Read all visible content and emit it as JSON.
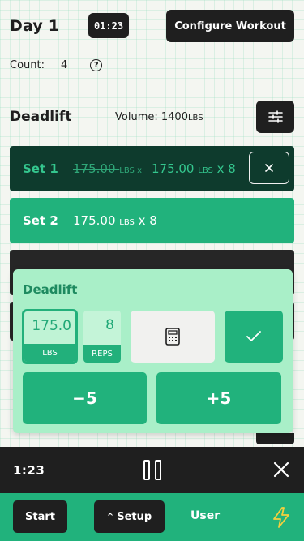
{
  "header": {
    "day_title": "Day 1",
    "timer": "01:23",
    "configure_label": "Configure Workout"
  },
  "count": {
    "label": "Count:",
    "value": "4",
    "help_glyph": "?"
  },
  "exercise": {
    "name": "Deadlift",
    "volume_label": "Volume:",
    "volume_value": "1400",
    "volume_unit": "LBS",
    "settings_icon": "sliders-icon"
  },
  "sets": [
    {
      "label": "Set 1",
      "prev_weight": "175.00",
      "prev_unit": "LBS x",
      "weight": "175.00",
      "unit": "LBS",
      "reps_text": " x 8",
      "state": "active"
    },
    {
      "label": "Set 2",
      "weight": "175.00",
      "unit": "LBS",
      "reps_text": " x 8",
      "state": "done"
    }
  ],
  "editor": {
    "title": "Deadlift",
    "weight_value": "175.0",
    "weight_tag": "LBS",
    "reps_value": "8",
    "reps_tag": "REPS",
    "minus_label": "−5",
    "plus_label": "+5",
    "calculator_icon": "calculator-icon",
    "confirm_icon": "check-icon"
  },
  "rest_timer": {
    "time": "1:23",
    "pause_icon": "pause-icon",
    "close_icon": "close-icon"
  },
  "bottom_nav": {
    "start_label": "Start",
    "setup_caret": "^",
    "setup_label": "Setup",
    "user_label": "User",
    "bolt_icon": "bolt-icon"
  },
  "colors": {
    "accent": "#21b27c",
    "dark": "#1f1f1f",
    "active_set_bg": "#0e3b2d",
    "popup_bg": "#a9efc8"
  }
}
